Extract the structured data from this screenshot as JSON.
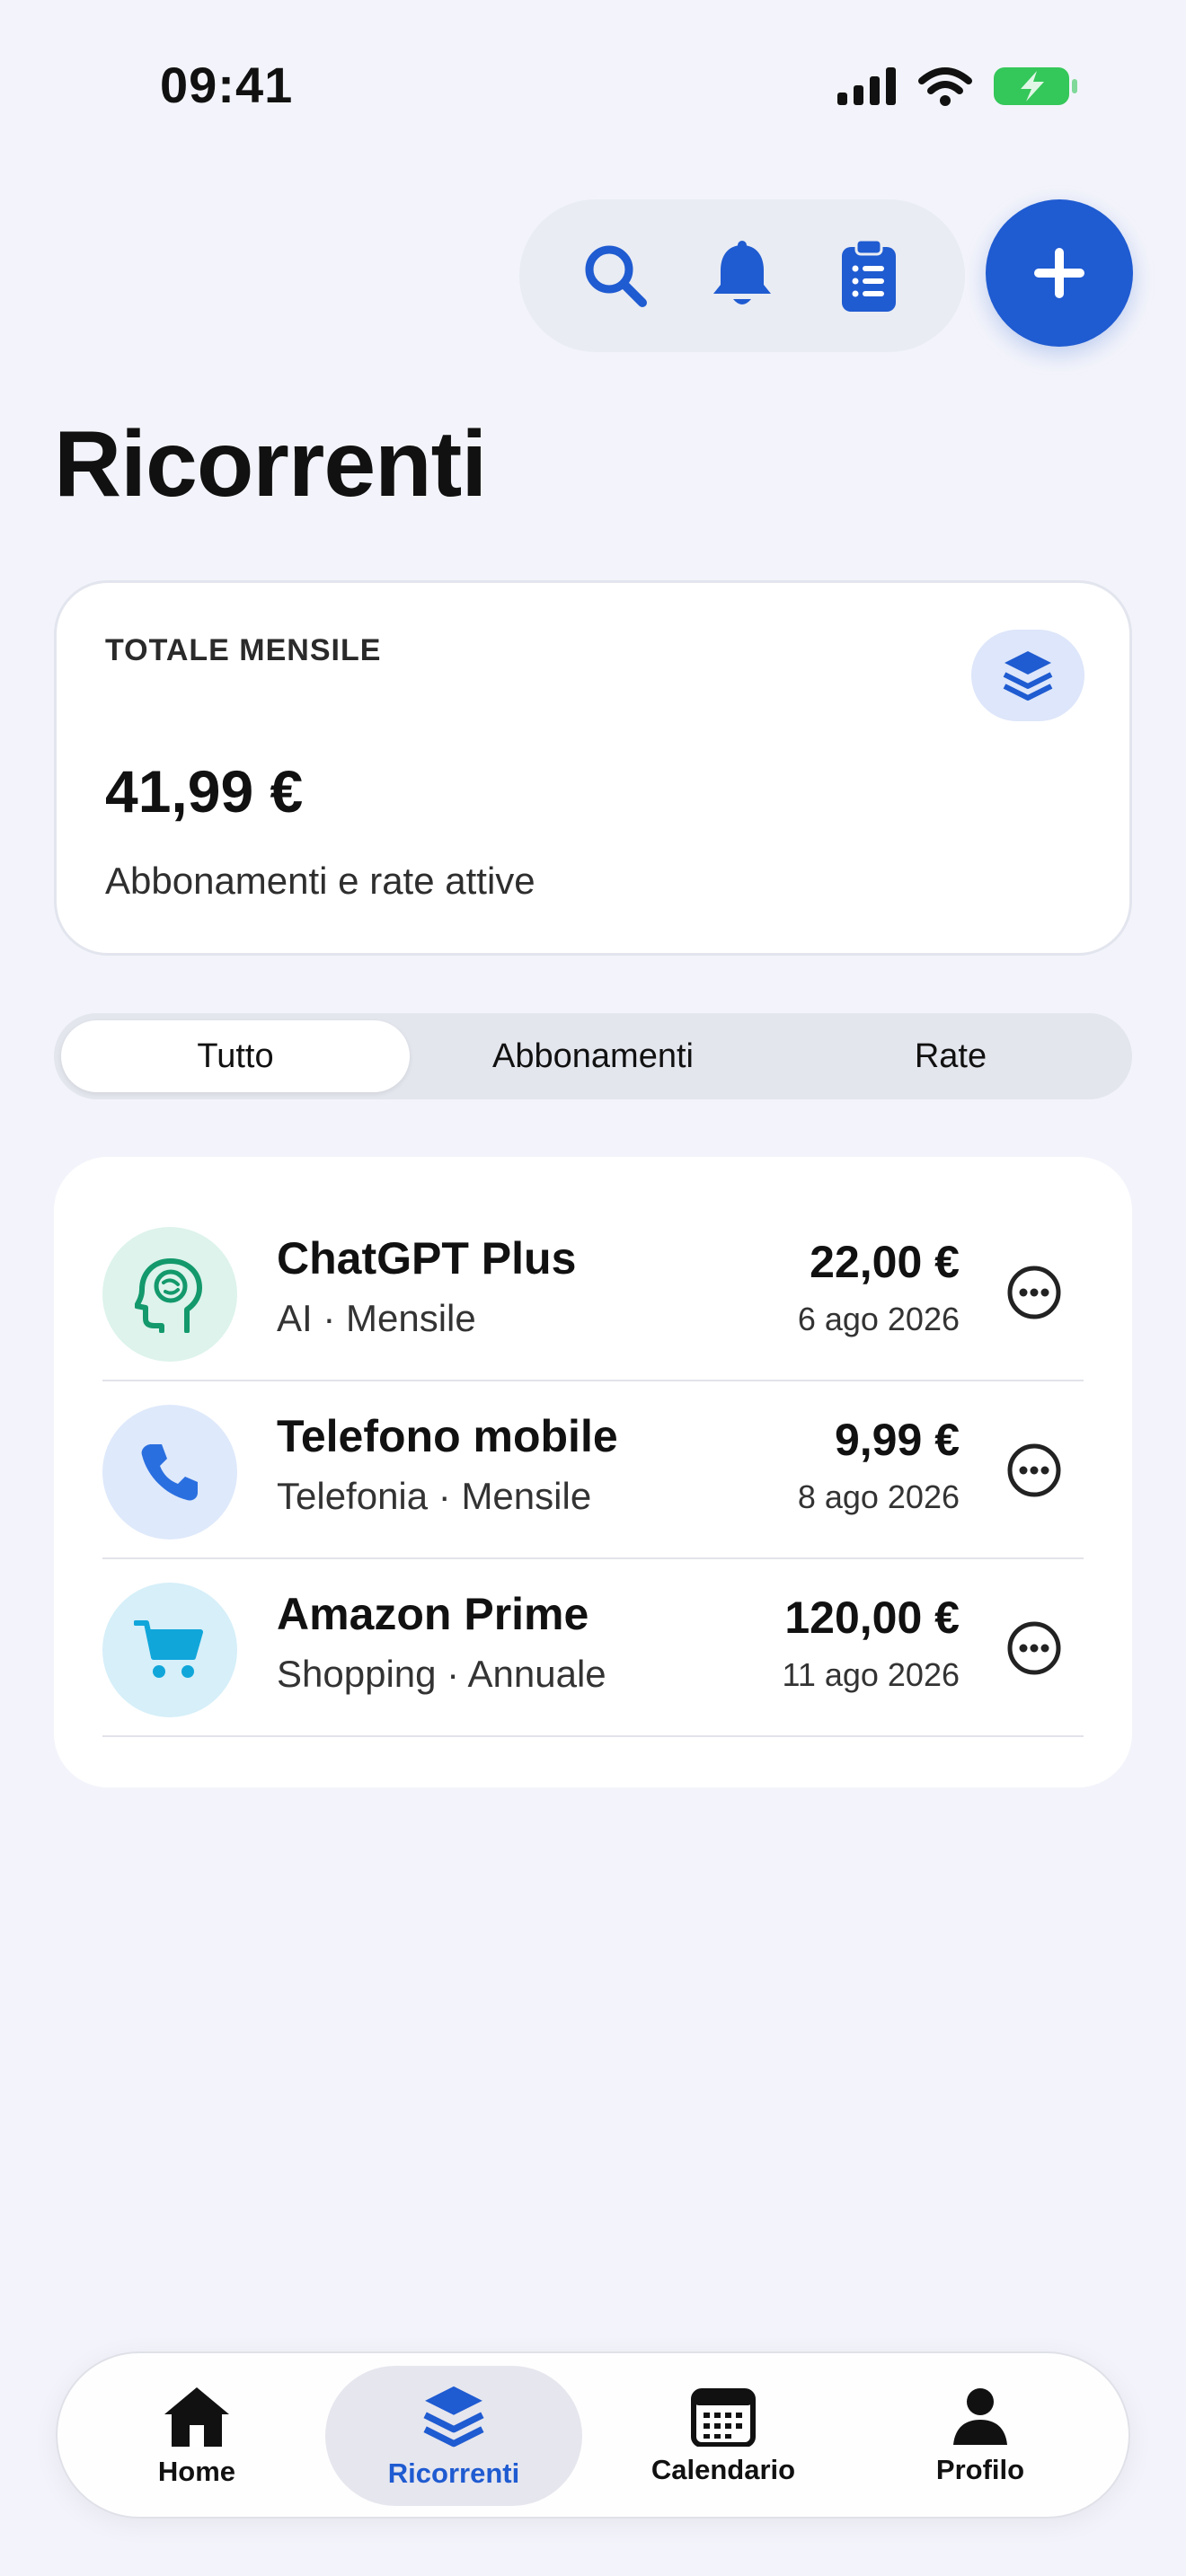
{
  "status_bar": {
    "time": "09:41"
  },
  "header": {
    "title": "Ricorrenti"
  },
  "summary": {
    "label": "TOTALE MENSILE",
    "amount": "41,99 €",
    "subtitle": "Abbonamenti e rate attive"
  },
  "filters": {
    "tabs": [
      {
        "label": "Tutto",
        "selected": true
      },
      {
        "label": "Abbonamenti",
        "selected": false
      },
      {
        "label": "Rate",
        "selected": false
      }
    ]
  },
  "items": [
    {
      "title": "ChatGPT Plus",
      "subtitle": "AI · Mensile",
      "amount": "22,00 €",
      "date": "6 ago 2026",
      "icon": "brain-icon",
      "icon_bg": "#DDF3EC",
      "icon_color": "#13996B"
    },
    {
      "title": "Telefono mobile",
      "subtitle": "Telefonia · Mensile",
      "amount": "9,99 €",
      "date": "8 ago 2026",
      "icon": "phone-icon",
      "icon_bg": "#DEE9FB",
      "icon_color": "#2A6FE0"
    },
    {
      "title": "Amazon Prime",
      "subtitle": "Shopping · Annuale",
      "amount": "120,00 €",
      "date": "11 ago 2026",
      "icon": "cart-icon",
      "icon_bg": "#D6EFF9",
      "icon_color": "#10A6DA"
    }
  ],
  "tabbar": {
    "items": [
      {
        "label": "Home",
        "icon": "house-icon",
        "active": false
      },
      {
        "label": "Ricorrenti",
        "icon": "stack-icon",
        "active": true
      },
      {
        "label": "Calendario",
        "icon": "calendar-icon",
        "active": false
      },
      {
        "label": "Profilo",
        "icon": "person-icon",
        "active": false
      }
    ]
  },
  "colors": {
    "accent": "#1F5BD1",
    "background": "#F3F4FB",
    "battery": "#34C759"
  }
}
